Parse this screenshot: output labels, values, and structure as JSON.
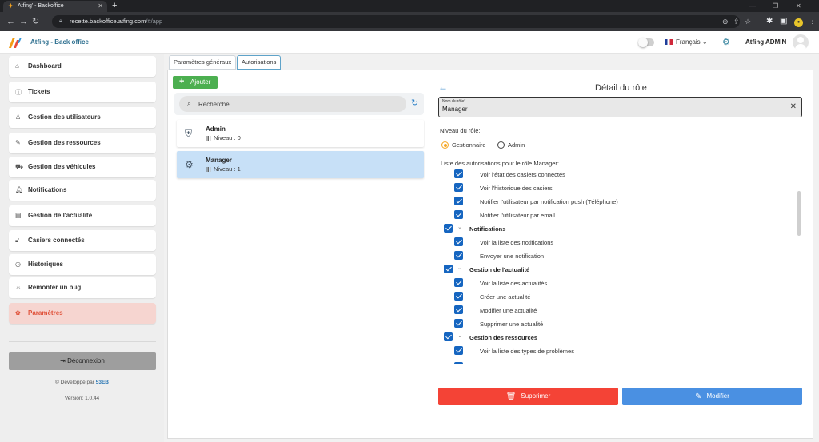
{
  "browser": {
    "tab_title": "Atfing' - Backoffice",
    "url_host": "recette.backoffice.atfing.com",
    "url_path": "/#/app"
  },
  "header": {
    "app_title": "Atfing - Back office",
    "language": "Français",
    "user_name": "Atfing ADMIN"
  },
  "sidebar": {
    "items": [
      {
        "label": "Dashboard",
        "icon": "home-icon"
      },
      {
        "label": "Tickets",
        "icon": "info-icon"
      },
      {
        "label": "Gestion des utilisateurs",
        "icon": "user-icon"
      },
      {
        "label": "Gestion des ressources",
        "icon": "edit-icon"
      },
      {
        "label": "Gestion des véhicules",
        "icon": "truck-icon"
      },
      {
        "label": "Notifications",
        "icon": "bell-icon"
      },
      {
        "label": "Gestion de l'actualité",
        "icon": "news-icon"
      },
      {
        "label": "Casiers connectés",
        "icon": "locker-icon"
      },
      {
        "label": "Historiques",
        "icon": "clock-icon"
      },
      {
        "label": "Remonter un bug",
        "icon": "bug-icon"
      },
      {
        "label": "Paramètres",
        "icon": "gear-icon"
      }
    ],
    "logout_label": "Déconnexion",
    "developed_by": "Développé par",
    "developer": "53EB",
    "version": "Version: 1.0.44"
  },
  "tabs": [
    {
      "label": "Paramètres généraux"
    },
    {
      "label": "Autorisations"
    }
  ],
  "roles": {
    "add_label": "Ajouter",
    "search_placeholder": "Recherche",
    "items": [
      {
        "name": "Admin",
        "level": "Niveau : 0"
      },
      {
        "name": "Manager",
        "level": "Niveau : 1"
      }
    ]
  },
  "detail": {
    "title": "Détail du rôle",
    "field_label": "Nom du rôle*",
    "field_value": "Manager",
    "level_label": "Niveau du rôle:",
    "options": [
      "Gestionnaire",
      "Admin"
    ],
    "permissions_title": "Liste des autorisations pour le rôle Manager:",
    "permissions": [
      {
        "label": "Voir l'état des casiers connectés",
        "group": false
      },
      {
        "label": "Voir l'historique des casiers",
        "group": false
      },
      {
        "label": "Notifier l'utilisateur par notification push (Téléphone)",
        "group": false
      },
      {
        "label": "Notifier l'utilisateur par email",
        "group": false
      },
      {
        "label": "Notifications",
        "group": true
      },
      {
        "label": "Voir la liste des notifications",
        "group": false
      },
      {
        "label": "Envoyer une notification",
        "group": false
      },
      {
        "label": "Gestion de l'actualité",
        "group": true
      },
      {
        "label": "Voir la liste des actualités",
        "group": false
      },
      {
        "label": "Créer une actualité",
        "group": false
      },
      {
        "label": "Modifier une actualité",
        "group": false
      },
      {
        "label": "Supprimer une actualité",
        "group": false
      },
      {
        "label": "Gestion des ressources",
        "group": true
      },
      {
        "label": "Voir la liste des types de problèmes",
        "group": false
      }
    ],
    "delete_label": "Supprimer",
    "edit_label": "Modifier"
  },
  "colors": {
    "accent": "#2b80c7",
    "active_sidebar": "#f6d5d0",
    "add_button": "#4caf50",
    "delete_button": "#f44336",
    "edit_button": "#4a90e2",
    "radio_selected": "#f5a623"
  }
}
